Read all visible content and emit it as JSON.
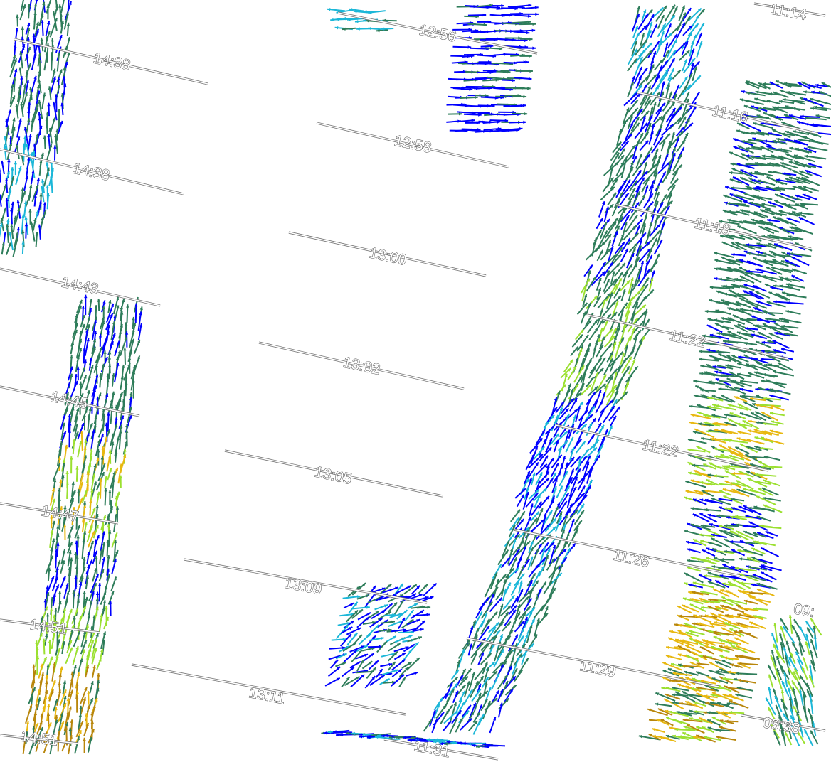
{
  "map": {
    "background_color": "#ffffff",
    "speed_colors": [
      "#0000ff",
      "#1bb7d8",
      "#2e7d5a",
      "#9be030",
      "#e8b810",
      "#b8860b"
    ],
    "track_labels": [
      "12:56",
      "12:58",
      "13:00",
      "13:02",
      "13:05",
      "13:09",
      "13:11",
      "14:38",
      "14:38",
      "14:43",
      "14:45",
      "14:47",
      "14:51",
      "14:51",
      "11:14",
      "11:16",
      "11:18",
      "11:22",
      "11:22",
      "11:26",
      "11:29",
      "11:31",
      "09:",
      "09:38"
    ]
  }
}
